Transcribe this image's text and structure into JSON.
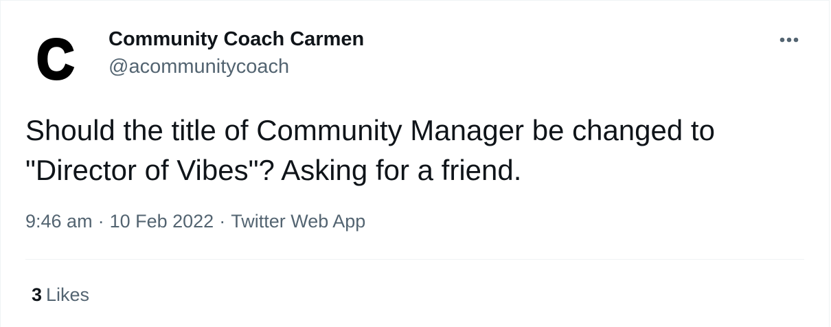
{
  "author": {
    "avatar_letter": "C",
    "display_name": "Community Coach Carmen",
    "handle": "@acommunitycoach"
  },
  "tweet": {
    "text": "Should the title of Community Manager be changed to\n\"Director of Vibes\"? Asking for a friend."
  },
  "meta": {
    "time": "9:46 am",
    "separator": "·",
    "date": "10 Feb 2022",
    "source": "Twitter Web App"
  },
  "stats": {
    "likes_count": "3",
    "likes_label": "Likes"
  },
  "icons": {
    "more": "more-horizontal-icon"
  },
  "colors": {
    "text_primary": "#0f1419",
    "text_secondary": "#536471",
    "divider": "#eff3f4",
    "background": "#ffffff"
  }
}
